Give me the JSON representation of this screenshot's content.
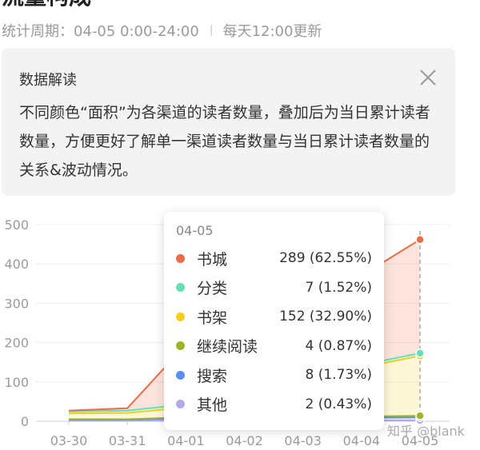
{
  "page": {
    "title": "流量构成",
    "period_label": "统计周期：04-05 0:00-24:00",
    "separator": "|",
    "update_note": "每天12:00更新"
  },
  "note": {
    "title": "数据解读",
    "body": "不同颜色“面积”为各渠道的读者数量，叠加后为当日累计读者数量，方便更好了解单一渠道读者数量与当日累计读者数量的关系&波动情况。",
    "close_icon": "close-icon"
  },
  "tooltip": {
    "date": "04-05",
    "rows": [
      {
        "name": "书城",
        "value": "289 (62.55%)",
        "color": "#ee6c45"
      },
      {
        "name": "分类",
        "value": "7 (1.52%)",
        "color": "#63e0b5"
      },
      {
        "name": "书架",
        "value": "152 (32.90%)",
        "color": "#f5cd1f"
      },
      {
        "name": "继续阅读",
        "value": "4 (0.87%)",
        "color": "#9eb52a"
      },
      {
        "name": "搜索",
        "value": "8 (1.73%)",
        "color": "#5a8ef0"
      },
      {
        "name": "其他",
        "value": "2 (0.43%)",
        "color": "#b6a8ea"
      }
    ]
  },
  "chart_data": {
    "type": "area",
    "stacked": true,
    "categories": [
      "03-30",
      "03-31",
      "04-01",
      "04-02",
      "04-03",
      "04-04",
      "04-05"
    ],
    "ylim": [
      0,
      500
    ],
    "yticks": [
      "0",
      "100",
      "200",
      "300",
      "400",
      "500"
    ],
    "grid": true,
    "series": [
      {
        "name": "其他",
        "color": "#b6a8ea",
        "values": [
          1,
          1,
          2,
          2,
          2,
          2,
          2
        ]
      },
      {
        "name": "搜索",
        "color": "#5a8ef0",
        "values": [
          3,
          3,
          5,
          5,
          6,
          7,
          8
        ]
      },
      {
        "name": "继续阅读",
        "color": "#9eb52a",
        "values": [
          1,
          1,
          3,
          3,
          4,
          3,
          4
        ]
      },
      {
        "name": "书架",
        "color": "#f5cd1f",
        "values": [
          15,
          16,
          25,
          70,
          95,
          125,
          152
        ]
      },
      {
        "name": "分类",
        "color": "#63e0b5",
        "values": [
          5,
          6,
          8,
          7,
          6,
          6,
          7
        ]
      },
      {
        "name": "书城",
        "color": "#ee6c45",
        "values": [
          2,
          6,
          152,
          190,
          210,
          227,
          289
        ]
      }
    ],
    "highlight_index": 6
  },
  "watermark": "知乎 @blank"
}
